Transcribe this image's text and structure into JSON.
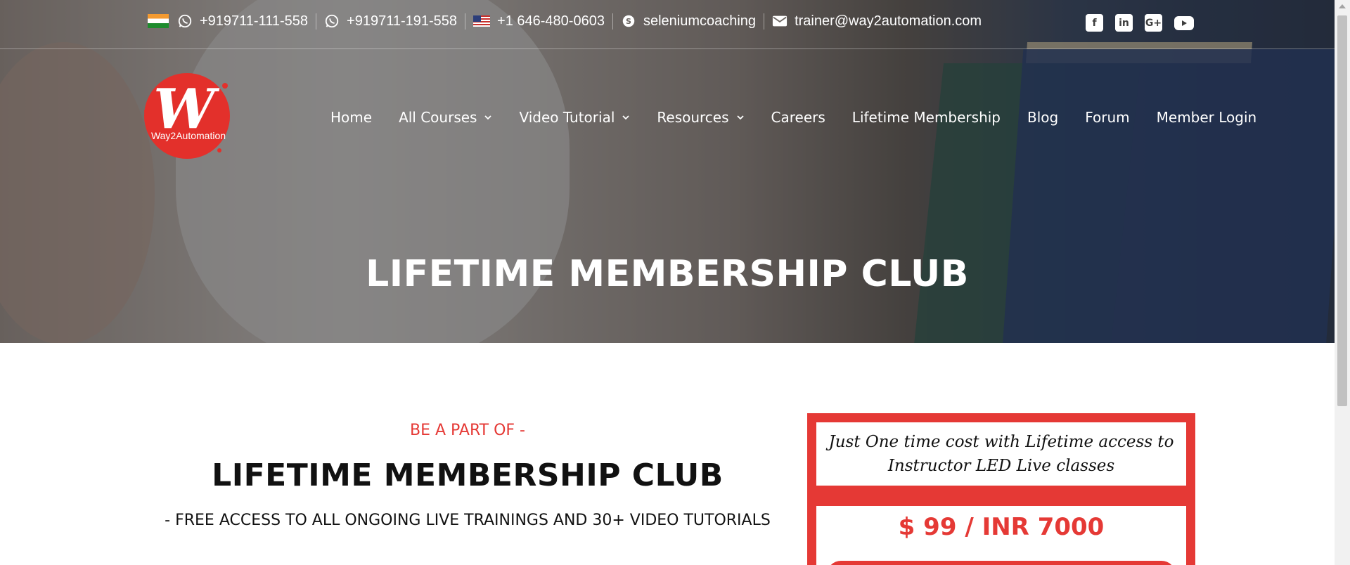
{
  "topbar": {
    "contacts": [
      {
        "icon": "whatsapp-icon",
        "text": "+919711-111-558"
      },
      {
        "icon": "whatsapp-icon",
        "text": "+919711-191-558"
      },
      {
        "icon": "us-flag-icon",
        "text": "+1 646-480-0603"
      },
      {
        "icon": "skype-icon",
        "text": "seleniumcoaching"
      },
      {
        "icon": "envelope-icon",
        "text": "trainer@way2automation.com"
      }
    ],
    "social": [
      "facebook-icon",
      "linkedin-icon",
      "google-plus-icon",
      "youtube-icon"
    ]
  },
  "logo": {
    "text": "Way2Automation",
    "letter": "W"
  },
  "nav": {
    "items": [
      {
        "label": "Home",
        "dropdown": false
      },
      {
        "label": "All Courses",
        "dropdown": true
      },
      {
        "label": "Video Tutorial",
        "dropdown": true
      },
      {
        "label": "Resources",
        "dropdown": true
      },
      {
        "label": "Careers",
        "dropdown": false
      },
      {
        "label": "Lifetime Membership",
        "dropdown": false
      },
      {
        "label": "Blog",
        "dropdown": false
      },
      {
        "label": "Forum",
        "dropdown": false
      },
      {
        "label": "Member Login",
        "dropdown": false
      }
    ]
  },
  "hero": {
    "title": "LIFETIME MEMBERSHIP CLUB"
  },
  "content": {
    "pre_title": "BE A PART OF -",
    "title": "LIFETIME MEMBERSHIP CLUB",
    "subtitle": "- FREE ACCESS TO ALL ONGOING LIVE TRAININGS AND 30+ VIDEO TUTORIALS"
  },
  "pricing": {
    "tagline_line1": "Just One time cost with Lifetime access to",
    "tagline_line2": "Instructor LED Live classes",
    "price": "$ 99 / INR 7000"
  },
  "colors": {
    "accent": "#e53935",
    "hero_text": "#ffffff"
  }
}
